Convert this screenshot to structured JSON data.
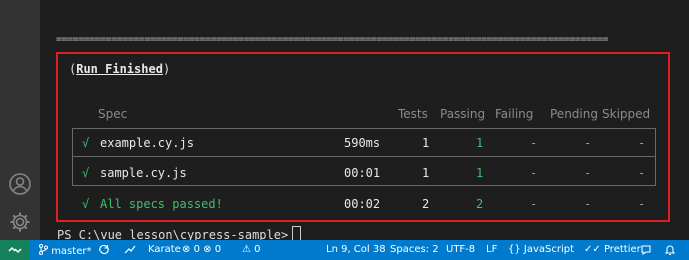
{
  "terminal": {
    "separator": "====================================================================================================",
    "run_open": "(",
    "run_finished": "Run Finished",
    "run_close": ")",
    "headers": {
      "spec": "Spec",
      "tests": "Tests",
      "passing": "Passing",
      "failing": "Failing",
      "pending": "Pending",
      "skipped": "Skipped"
    },
    "rows": [
      {
        "check": "√",
        "spec": "example.cy.js",
        "time": "590ms",
        "tests": "1",
        "passing": "1",
        "failing": "-",
        "pending": "-",
        "skipped": "-"
      },
      {
        "check": "√",
        "spec": "sample.cy.js",
        "time": "00:01",
        "tests": "1",
        "passing": "1",
        "failing": "-",
        "pending": "-",
        "skipped": "-"
      }
    ],
    "summary": {
      "check": "√",
      "text": "All specs passed!",
      "time": "00:02",
      "tests": "2",
      "passing": "2",
      "failing": "-",
      "pending": "-",
      "skipped": "-"
    },
    "prompt": "PS C:\\vue_lesson\\cypress-sample>"
  },
  "statusbar": {
    "branch": "master*",
    "karate": "Karate",
    "errors": "0",
    "warnings": "0",
    "info": "0",
    "position": "Ln 9, Col 38",
    "spaces": "Spaces: 2",
    "encoding": "UTF-8",
    "eol": "LF",
    "language": "JavaScript",
    "prettier": "Prettier"
  },
  "colors": {
    "statusbar": "#007acc",
    "remote": "#16825d",
    "highlight_box": "#e02020",
    "pass_green": "#3fbf6f"
  }
}
